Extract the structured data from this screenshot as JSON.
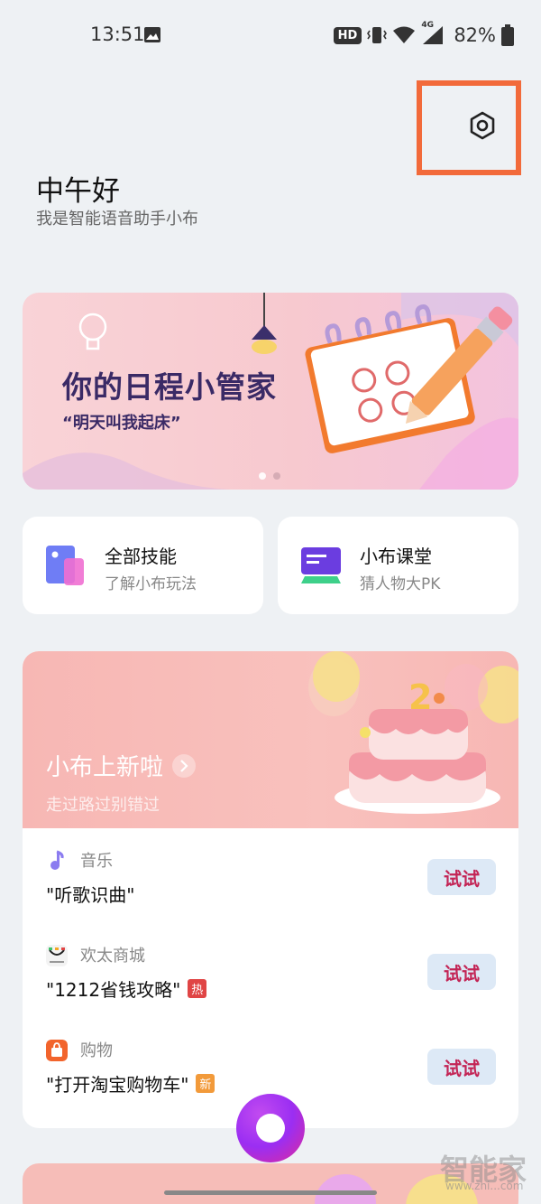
{
  "status_bar": {
    "time": "13:51",
    "hd": "HD",
    "battery": "82%",
    "network": "4G"
  },
  "header": {
    "greeting": "中午好",
    "subtitle": "我是智能语音助手小布",
    "settings_icon": "gear-icon",
    "highlight_color": "#f26a3a"
  },
  "banner": {
    "title": "你的日程小管家",
    "subtitle": "“明天叫我起床”",
    "page_indicator": {
      "count": 2,
      "active": 0
    }
  },
  "skills": [
    {
      "title": "全部技能",
      "desc": "了解小布玩法",
      "icon": "skills-icon"
    },
    {
      "title": "小布课堂",
      "desc": "猜人物大PK",
      "icon": "classroom-icon"
    }
  ],
  "new_features": {
    "title": "小布上新啦",
    "subtitle": "走过路过别错过",
    "items": [
      {
        "category": "音乐",
        "phrase": "\"听歌识曲\"",
        "tag": "",
        "button": "试试",
        "icon": "music-icon"
      },
      {
        "category": "欢太商城",
        "phrase": "\"1212省钱攻略\"",
        "tag": "热",
        "button": "试试",
        "icon": "store-icon"
      },
      {
        "category": "购物",
        "phrase": "\"打开淘宝购物车\"",
        "tag": "新",
        "button": "试试",
        "icon": "shopping-bag-icon"
      }
    ]
  },
  "watermark": {
    "text": "智能家",
    "url": "www.zhi...com"
  },
  "colors": {
    "background": "#eef1f4",
    "try_button_bg": "#dde9f6",
    "try_button_text": "#c32455",
    "banner_title": "#3a2a66"
  }
}
